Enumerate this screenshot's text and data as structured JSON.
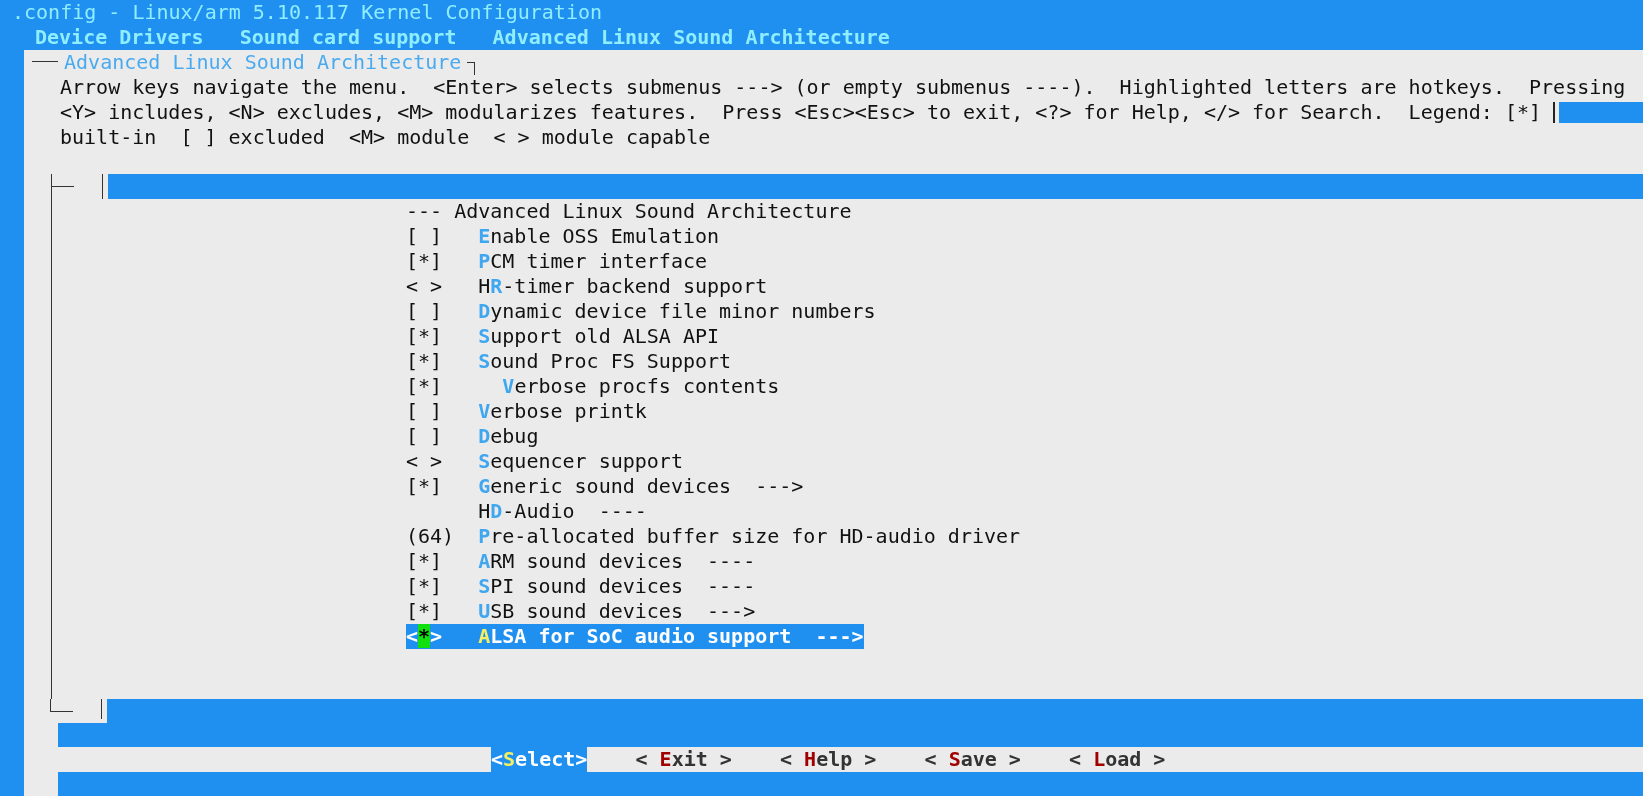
{
  "window": {
    "title": ".config - Linux/arm 5.10.117 Kernel Configuration"
  },
  "breadcrumbs": [
    "Device Drivers",
    "Sound card support",
    "Advanced Linux Sound Architecture"
  ],
  "dialog": {
    "title": "Advanced Linux Sound Architecture",
    "help_lines": [
      "Arrow keys navigate the menu.  <Enter> selects submenus ---> (or empty submenus ----).  Highlighted letters are hotkeys.  Pressing",
      "<Y> includes, <N> excludes, <M> modularizes features.  Press <Esc><Esc> to exit, <?> for Help, </> for Search.  Legend: [*]",
      "built-in  [ ] excluded  <M> module  < > module capable"
    ]
  },
  "menu": {
    "items": [
      {
        "kind": "comment",
        "text": "--- Advanced Linux Sound Architecture",
        "selected": false
      },
      {
        "kind": "option",
        "prompt": "[ ]",
        "key": "E",
        "post": "nable OSS Emulation",
        "selected": false
      },
      {
        "kind": "option",
        "prompt": "[*]",
        "key": "P",
        "post": "CM timer interface",
        "selected": false
      },
      {
        "kind": "option",
        "prompt": "< >",
        "pre": "H",
        "key": "R",
        "post": "-timer backend support",
        "selected": false
      },
      {
        "kind": "option",
        "prompt": "[ ]",
        "key": "D",
        "post": "ynamic device file minor numbers",
        "selected": false
      },
      {
        "kind": "option",
        "prompt": "[*]",
        "key": "S",
        "post": "upport old ALSA API",
        "selected": false
      },
      {
        "kind": "option",
        "prompt": "[*]",
        "key": "S",
        "post": "ound Proc FS Support",
        "selected": false,
        "children": [
          {
            "kind": "option",
            "prompt": "[*]",
            "key": "V",
            "post": "erbose procfs contents",
            "selected": false
          }
        ]
      },
      {
        "kind": "option",
        "prompt": "[ ]",
        "key": "V",
        "post": "erbose printk",
        "selected": false
      },
      {
        "kind": "option",
        "prompt": "[ ]",
        "key": "D",
        "post": "ebug",
        "selected": false
      },
      {
        "kind": "option",
        "prompt": "< >",
        "key": "S",
        "post": "equencer support",
        "selected": false
      },
      {
        "kind": "option",
        "prompt": "[*]",
        "key": "G",
        "post": "eneric sound devices  --->",
        "selected": false
      },
      {
        "kind": "option",
        "pre": "H",
        "key": "D",
        "post": "-Audio  ----",
        "selected": false
      },
      {
        "kind": "option",
        "prompt": "(64)",
        "key": "P",
        "post": "re-allocated buffer size for HD-audio driver",
        "selected": false
      },
      {
        "kind": "option",
        "prompt": "[*]",
        "key": "A",
        "post": "RM sound devices  ----",
        "selected": false
      },
      {
        "kind": "option",
        "prompt": "[*]",
        "key": "S",
        "post": "PI sound devices  ----",
        "selected": false
      },
      {
        "kind": "option",
        "prompt": "[*]",
        "key": "U",
        "post": "SB sound devices  --->",
        "selected": false
      },
      {
        "kind": "option",
        "prompt": "<*>",
        "key": "A",
        "post": "LSA for SoC audio support  --->",
        "selected": true
      }
    ]
  },
  "buttons": [
    {
      "pre": "<",
      "key": "S",
      "post": "elect>",
      "selected": true
    },
    {
      "pre": "< ",
      "key": "E",
      "post": "xit >",
      "selected": false
    },
    {
      "pre": "< ",
      "key": "H",
      "post": "elp >",
      "selected": false
    },
    {
      "pre": "< ",
      "key": "S",
      "post": "ave >",
      "selected": false
    },
    {
      "pre": "< ",
      "key": "L",
      "post": "oad >",
      "selected": false
    }
  ]
}
